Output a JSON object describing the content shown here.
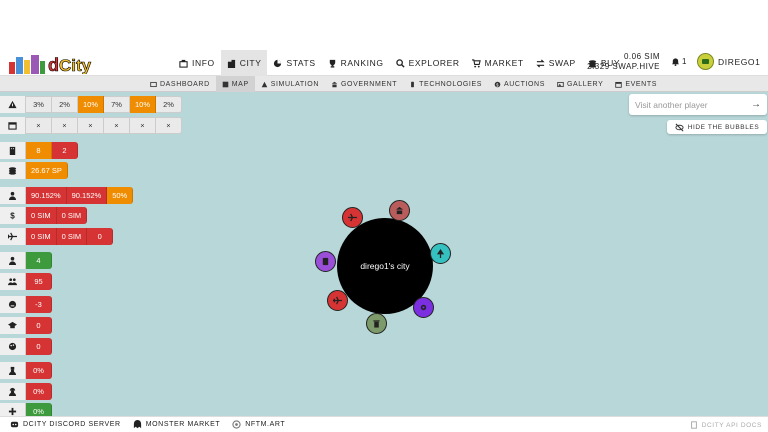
{
  "brand": {
    "logo_text": "dCity"
  },
  "nav": [
    {
      "label": "INFO",
      "icon": "info-icon"
    },
    {
      "label": "CITY",
      "icon": "city-icon",
      "active": true
    },
    {
      "label": "STATS",
      "icon": "stats-icon"
    },
    {
      "label": "RANKING",
      "icon": "trophy-icon"
    },
    {
      "label": "EXPLORER",
      "icon": "search-icon"
    },
    {
      "label": "MARKET",
      "icon": "cart-icon"
    },
    {
      "label": "SWAP",
      "icon": "swap-icon"
    },
    {
      "label": "BUY",
      "icon": "coins-icon"
    }
  ],
  "wallet": {
    "sim": "0.06 SIM",
    "swap_hive": "2.329 SWAP.HIVE"
  },
  "notifications": {
    "count": "1"
  },
  "user": {
    "name": "DIREGO1"
  },
  "subnav": [
    {
      "label": "DASHBOARD",
      "icon": "dashboard-icon"
    },
    {
      "label": "MAP",
      "icon": "map-icon",
      "active": true
    },
    {
      "label": "SIMULATION",
      "icon": "simulation-icon"
    },
    {
      "label": "GOVERNMENT",
      "icon": "government-icon"
    },
    {
      "label": "TECHNOLOGIES",
      "icon": "tech-icon"
    },
    {
      "label": "AUCTIONS",
      "icon": "auction-icon"
    },
    {
      "label": "GALLERY",
      "icon": "gallery-icon"
    },
    {
      "label": "EVENTS",
      "icon": "calendar-icon"
    }
  ],
  "stats": {
    "risk": [
      "3%",
      "2%",
      "10%",
      "7%",
      "10%",
      "2%"
    ],
    "events": [
      "×",
      "×",
      "×",
      "×",
      "×",
      "×"
    ],
    "buildings": [
      "8",
      "2"
    ],
    "sp": [
      "26.67 SP"
    ],
    "workers": [
      "90.152%",
      "90.152%",
      "50%"
    ],
    "income": [
      "0 SIM",
      "0 SIM"
    ],
    "tourism": [
      "0 SIM",
      "0 SIM",
      "0"
    ],
    "population": [
      "4"
    ],
    "citizens": [
      "95"
    ],
    "happiness": [
      "-3"
    ],
    "education": [
      "0"
    ],
    "creativity": [
      "0"
    ],
    "crime": [
      "0%"
    ],
    "unemployment": [
      "0%"
    ],
    "health": [
      "0%"
    ]
  },
  "search": {
    "placeholder": "Visit another player"
  },
  "hide_bubbles": {
    "label": "HIDE THE BUBBLES"
  },
  "city": {
    "name": "dirego1's city"
  },
  "footer": {
    "discord": "DCITY DISCORD SERVER",
    "monster": "MONSTER MARKET",
    "nftm": "NFTM.ART",
    "api": "DCITY API DOCS"
  },
  "colors": {
    "orange": "#f08c00",
    "red": "#d63434",
    "green": "#3d9a3d",
    "map_bg": "#b8d7d8"
  }
}
